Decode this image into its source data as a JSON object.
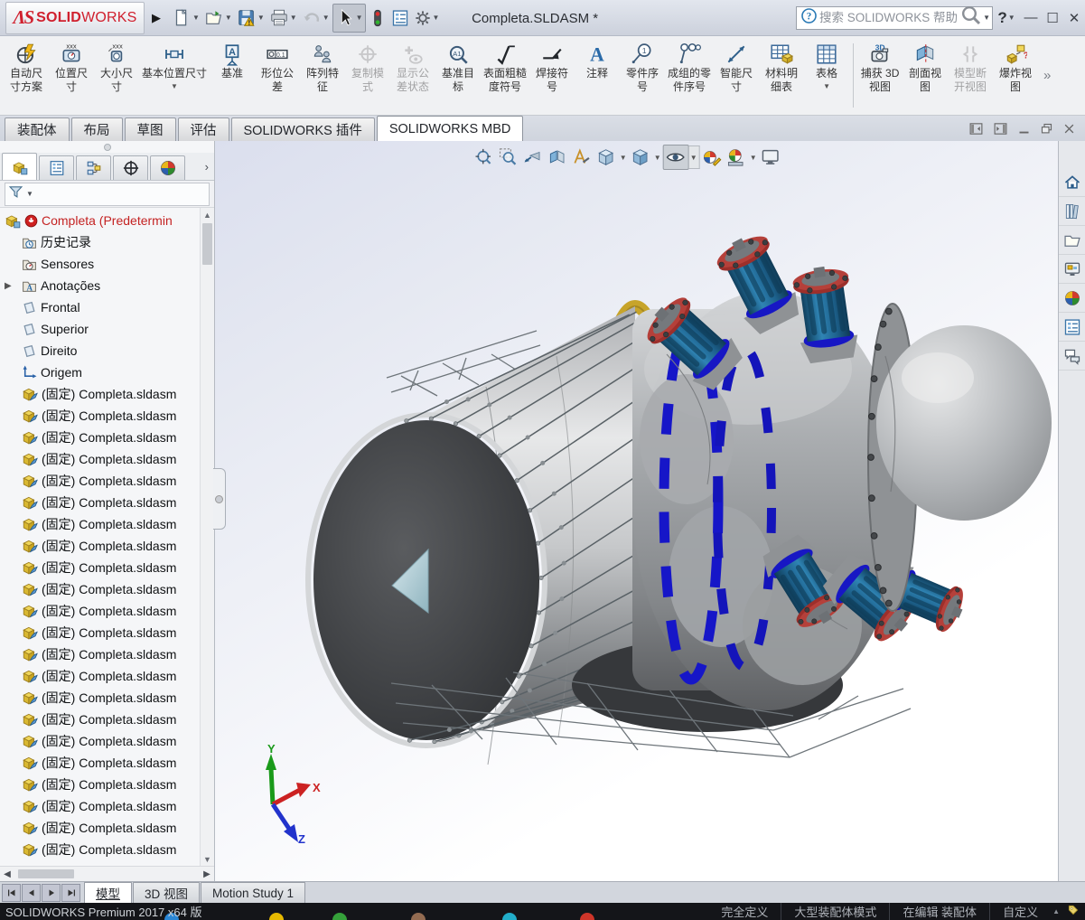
{
  "window": {
    "title": "Completa.SLDASM *",
    "brand": {
      "glyph": "ΛS",
      "bold": "SOLID",
      "light": "WORKS"
    },
    "controls": [
      "help",
      "minimize",
      "maximize",
      "close"
    ]
  },
  "quick_access": [
    {
      "name": "new-document",
      "icon": "new-document",
      "dropdown": true
    },
    {
      "name": "open",
      "icon": "open",
      "dropdown": true
    },
    {
      "name": "save",
      "icon": "save",
      "dropdown": true
    },
    {
      "name": "print",
      "icon": "print",
      "dropdown": true
    },
    {
      "name": "undo",
      "icon": "undo",
      "dropdown": true,
      "disabled": true
    },
    {
      "name": "select",
      "icon": "select-cursor",
      "dropdown": true,
      "pressed": true
    },
    {
      "name": "interference-check",
      "icon": "traffic-light",
      "dropdown": false
    },
    {
      "name": "document-properties",
      "icon": "document-properties",
      "dropdown": false
    },
    {
      "name": "options",
      "icon": "options-gear",
      "dropdown": true
    }
  ],
  "search": {
    "placeholder": "搜索 SOLIDWORKS 帮助"
  },
  "ribbon": {
    "overflow": "»",
    "items": [
      {
        "name": "auto-dimension-scheme",
        "icon": "autodim",
        "lines": [
          "自动尺",
          "寸方案"
        ]
      },
      {
        "name": "location-dimension",
        "icon": "dimgauge",
        "lines": [
          "位置尺",
          "寸"
        ]
      },
      {
        "name": "size-dimension",
        "icon": "dimgauge2",
        "lines": [
          "大小尺",
          "寸"
        ]
      },
      {
        "name": "basic-location-dimension",
        "icon": "basicdim",
        "lines": [
          "基本位置尺寸"
        ],
        "dropdown": true
      },
      {
        "name": "datum",
        "icon": "datum",
        "lines": [
          "基准"
        ]
      },
      {
        "name": "geometric-tolerance",
        "icon": "gtol",
        "lines": [
          "形位公",
          "差"
        ]
      },
      {
        "name": "pattern-feature",
        "icon": "pattern",
        "lines": [
          "阵列特",
          "征"
        ]
      },
      {
        "name": "copy-scheme",
        "icon": "copyscheme",
        "lines": [
          "复制模",
          "式"
        ],
        "disabled": true
      },
      {
        "name": "show-tolerance-status",
        "icon": "tolstatus",
        "lines": [
          "显示公",
          "差状态"
        ],
        "disabled": true
      },
      {
        "name": "datum-target",
        "icon": "datumtarget",
        "lines": [
          "基准目",
          "标"
        ]
      },
      {
        "name": "surface-finish-symbol",
        "icon": "surffinish",
        "lines": [
          "表面粗糙",
          "度符号"
        ]
      },
      {
        "name": "weld-symbol",
        "icon": "weldsym",
        "lines": [
          "焊接符",
          "号"
        ]
      },
      {
        "name": "note",
        "icon": "note",
        "lines": [
          "注释"
        ]
      },
      {
        "name": "balloon",
        "icon": "balloon",
        "lines": [
          "零件序",
          "号"
        ]
      },
      {
        "name": "stacked-balloon",
        "icon": "stackballoon",
        "lines": [
          "成组的零",
          "件序号"
        ]
      },
      {
        "name": "smart-dimension",
        "icon": "smartdim",
        "lines": [
          "智能尺",
          "寸"
        ]
      },
      {
        "name": "bill-of-materials",
        "icon": "bom",
        "lines": [
          "材料明",
          "细表"
        ]
      },
      {
        "name": "tables",
        "icon": "tablegrid",
        "lines": [
          "表格"
        ],
        "dropdown": true
      },
      {
        "separator": true
      },
      {
        "name": "capture-3d-view",
        "icon": "capture3d",
        "lines": [
          "捕获 3D",
          "视图"
        ]
      },
      {
        "name": "section-view",
        "icon": "sectionview",
        "lines": [
          "剖面视",
          "图"
        ]
      },
      {
        "name": "model-break-view",
        "icon": "breakview",
        "lines": [
          "模型断",
          "开视图"
        ],
        "disabled": true
      },
      {
        "name": "exploded-view",
        "icon": "explode",
        "lines": [
          "爆炸视",
          "图"
        ]
      }
    ]
  },
  "command_tabs": {
    "items": [
      "装配体",
      "布局",
      "草图",
      "评估",
      "SOLIDWORKS 插件",
      "SOLIDWORKS MBD"
    ],
    "active_index": 5
  },
  "pane_controls": [
    "collapse-left-pane",
    "collapse-right-pane",
    "minimize-doc",
    "restore-doc",
    "close-doc"
  ],
  "manager_tabs": [
    "featuremanager",
    "property-manager",
    "configuration-manager",
    "dimxpert-manager",
    "display-manager"
  ],
  "feature_tree": {
    "root": {
      "label": "Completa (Predetermin",
      "icon": "assembly",
      "badge": "rebuild-error"
    },
    "items": [
      {
        "label": "历史记录",
        "icon": "history-folder"
      },
      {
        "label": "Sensores",
        "icon": "sensors-folder"
      },
      {
        "label": "Anotações",
        "icon": "annotations-folder",
        "expandable": true
      },
      {
        "label": "Frontal",
        "icon": "plane"
      },
      {
        "label": "Superior",
        "icon": "plane"
      },
      {
        "label": "Direito",
        "icon": "plane"
      },
      {
        "label": "Origem",
        "icon": "origin"
      },
      {
        "label": "(固定) Completa.sldasm",
        "icon": "component"
      },
      {
        "label": "(固定) Completa.sldasm",
        "icon": "component"
      },
      {
        "label": "(固定) Completa.sldasm",
        "icon": "component"
      },
      {
        "label": "(固定) Completa.sldasm",
        "icon": "component"
      },
      {
        "label": "(固定) Completa.sldasm",
        "icon": "component"
      },
      {
        "label": "(固定) Completa.sldasm",
        "icon": "component"
      },
      {
        "label": "(固定) Completa.sldasm",
        "icon": "component"
      },
      {
        "label": "(固定) Completa.sldasm",
        "icon": "component"
      },
      {
        "label": "(固定) Completa.sldasm",
        "icon": "component"
      },
      {
        "label": "(固定) Completa.sldasm",
        "icon": "component"
      },
      {
        "label": "(固定) Completa.sldasm",
        "icon": "component"
      },
      {
        "label": "(固定) Completa.sldasm",
        "icon": "component"
      },
      {
        "label": "(固定) Completa.sldasm",
        "icon": "component"
      },
      {
        "label": "(固定) Completa.sldasm",
        "icon": "component"
      },
      {
        "label": "(固定) Completa.sldasm",
        "icon": "component"
      },
      {
        "label": "(固定) Completa.sldasm",
        "icon": "component"
      },
      {
        "label": "(固定) Completa.sldasm",
        "icon": "component"
      },
      {
        "label": "(固定) Completa.sldasm",
        "icon": "component"
      },
      {
        "label": "(固定) Completa.sldasm",
        "icon": "component"
      },
      {
        "label": "(固定) Completa.sldasm",
        "icon": "component"
      },
      {
        "label": "(固定) Completa.sldasm",
        "icon": "component"
      },
      {
        "label": "(固定) Completa.sldasm",
        "icon": "component"
      }
    ]
  },
  "headsup_toolbar": [
    {
      "name": "zoom-to-fit",
      "icon": "zoomfit"
    },
    {
      "name": "zoom-to-area",
      "icon": "zoomarea"
    },
    {
      "name": "previous-view",
      "icon": "prevview"
    },
    {
      "name": "section-view",
      "icon": "hsection"
    },
    {
      "name": "hide-show-annotations",
      "icon": "hideanno"
    },
    {
      "name": "view-orientation",
      "icon": "vieworient",
      "dropdown": true
    },
    {
      "name": "display-style",
      "icon": "dispstyle",
      "dropdown": true
    },
    {
      "name": "hide-show-items",
      "icon": "hideshow",
      "dropdown": true,
      "pressed": true
    },
    {
      "name": "edit-appearance",
      "icon": "editappear"
    },
    {
      "name": "apply-scene",
      "icon": "applyscene",
      "dropdown": true
    },
    {
      "name": "view-settings",
      "icon": "viewsettings"
    }
  ],
  "task_pane": [
    {
      "name": "home",
      "icon": "home"
    },
    {
      "name": "design-library",
      "icon": "library"
    },
    {
      "name": "file-explorer",
      "icon": "folderx"
    },
    {
      "name": "view-palette",
      "icon": "viewpalette"
    },
    {
      "name": "appearances-scenes",
      "icon": "sphere"
    },
    {
      "name": "custom-properties",
      "icon": "customprops"
    },
    {
      "name": "solidworks-forum",
      "icon": "forum"
    }
  ],
  "bottom_tabs": {
    "items": [
      "模型",
      "3D 视图",
      "Motion Study 1"
    ],
    "active_index": 0
  },
  "status_bar": {
    "left": "SOLIDWORKS Premium 2017 x64 版",
    "items": [
      "完全定义",
      "大型装配体模式",
      "在编辑 装配体",
      "自定义"
    ]
  },
  "viewport": {
    "triad_labels": {
      "x": "X",
      "y": "Y",
      "z": "Z"
    },
    "model_palette": {
      "body_gray": "#9b9ea2",
      "highlight": "#e9eaeb",
      "dark_interior": "#35373a",
      "yellow_ring": "#c7a42a",
      "teal_cylinder": "#1d6f9e",
      "red_flange": "#b23430",
      "bright_blue_ring": "#1616c8",
      "spike_blue": "#b9d3da",
      "triad_x": "#cc2222",
      "triad_y": "#1a9a1a",
      "triad_z": "#2233cc"
    }
  }
}
